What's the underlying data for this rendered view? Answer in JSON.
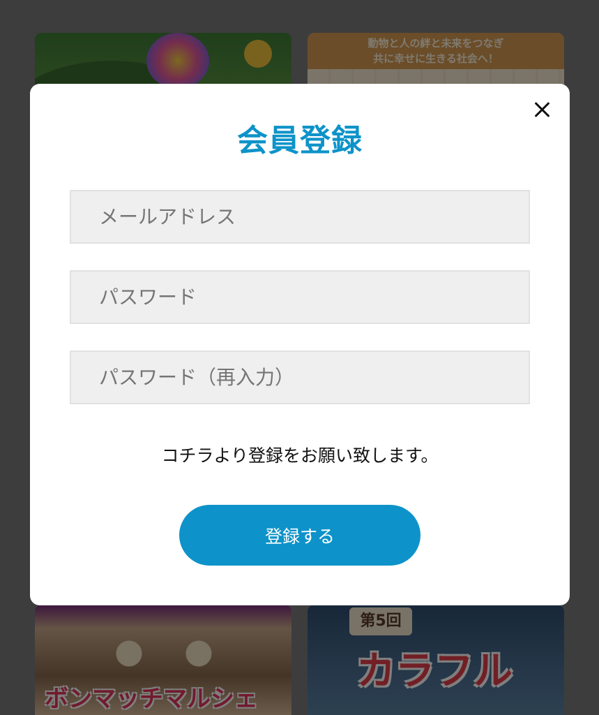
{
  "modal": {
    "title": "会員登録",
    "email_placeholder": "メールアドレス",
    "password_placeholder": "パスワード",
    "password_confirm_placeholder": "パスワード（再入力）",
    "message": "コチラより登録をお願い致します。",
    "submit_label": "登録する",
    "close_icon": "close-icon",
    "accent_color": "#0d93c9"
  },
  "background_cards": {
    "card_2_banner": "動物と人の絆と未来をつなぎ\n共に幸せに生きる社会へ！",
    "card_3_title": "ボンマッチマルシェ",
    "card_4_badge": "第5回",
    "card_4_title": "カラフル"
  }
}
